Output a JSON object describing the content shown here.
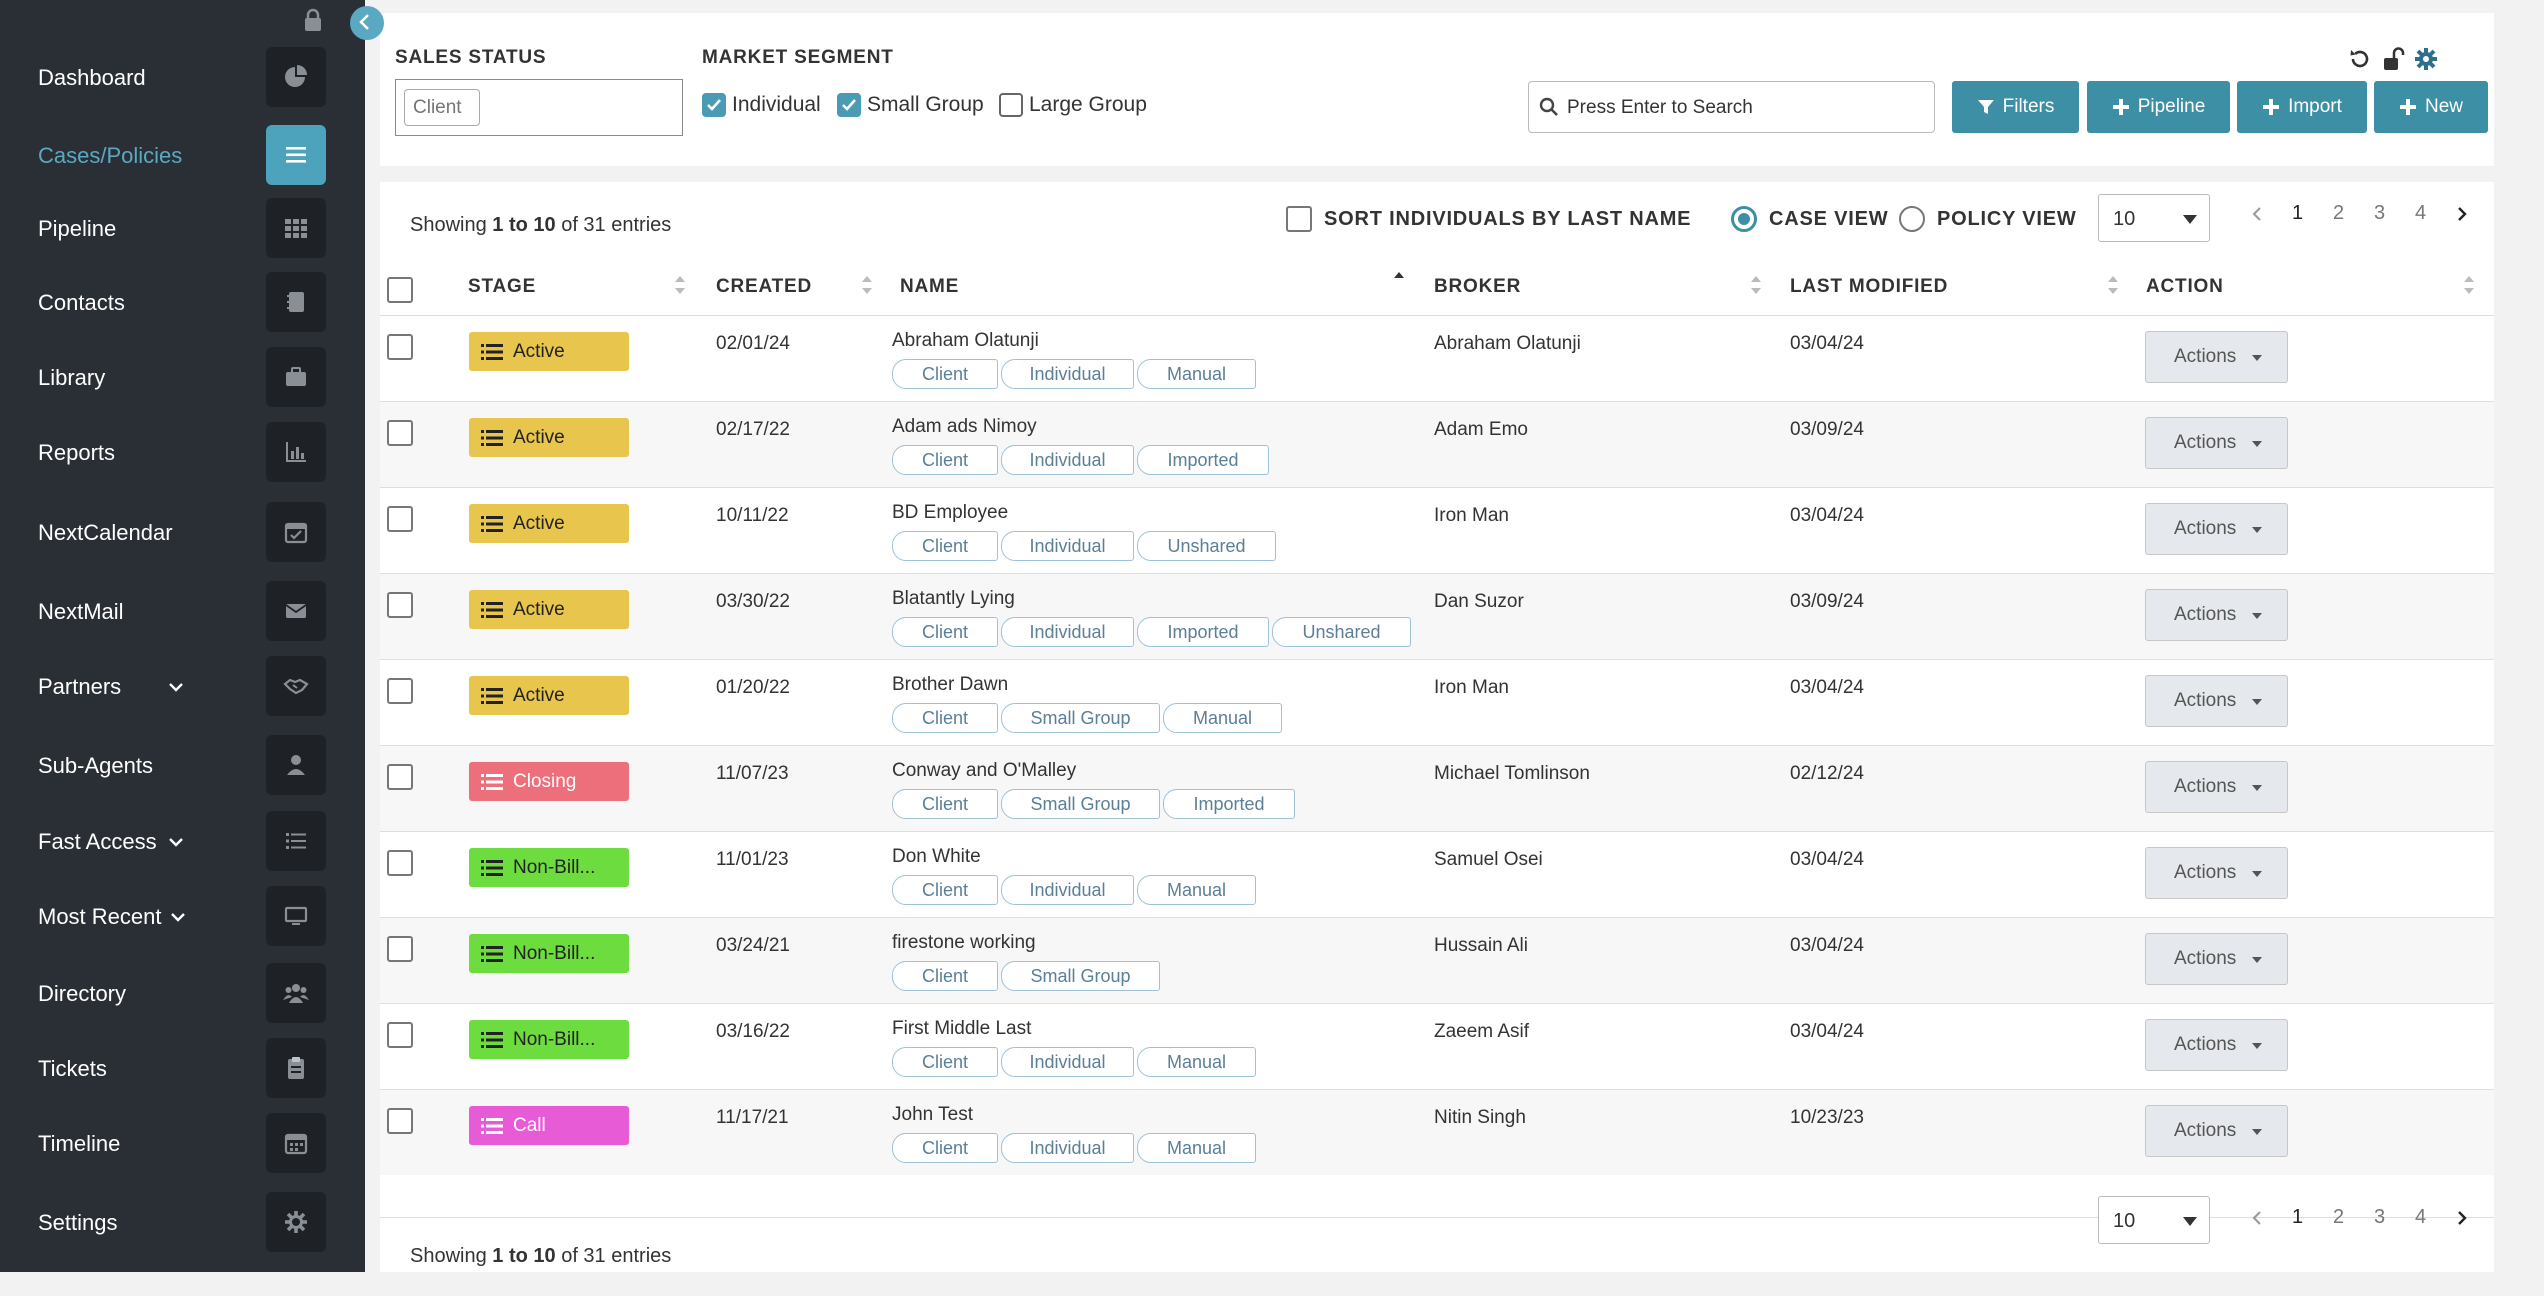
{
  "sidebar": {
    "items": [
      {
        "label": "Dashboard",
        "icon": "pie-chart-icon"
      },
      {
        "label": "Cases/Policies",
        "icon": "list-icon",
        "active": true
      },
      {
        "label": "Pipeline",
        "icon": "grid-icon"
      },
      {
        "label": "Contacts",
        "icon": "address-book-icon"
      },
      {
        "label": "Library",
        "icon": "briefcase-icon"
      },
      {
        "label": "Reports",
        "icon": "bar-chart-icon"
      },
      {
        "label": "NextCalendar",
        "icon": "calendar-check-icon"
      },
      {
        "label": "NextMail",
        "icon": "envelope-icon"
      },
      {
        "label": "Partners",
        "icon": "handshake-icon",
        "expandable": true
      },
      {
        "label": "Sub-Agents",
        "icon": "user-icon"
      },
      {
        "label": "Fast Access",
        "icon": "list-bullets-icon",
        "expandable": true
      },
      {
        "label": "Most Recent",
        "icon": "monitor-icon",
        "expandable": true
      },
      {
        "label": "Directory",
        "icon": "users-icon"
      },
      {
        "label": "Tickets",
        "icon": "clipboard-icon"
      },
      {
        "label": "Timeline",
        "icon": "calendar-icon"
      },
      {
        "label": "Settings",
        "icon": "gear-icon"
      }
    ],
    "accent": "#5aa8c2"
  },
  "filters": {
    "sales_status_title": "SALES STATUS",
    "client_placeholder": "Client",
    "market_segment_title": "MARKET SEGMENT",
    "segments": [
      {
        "label": "Individual",
        "checked": true
      },
      {
        "label": "Small Group",
        "checked": true
      },
      {
        "label": "Large Group",
        "checked": false
      }
    ],
    "search_placeholder": "Press Enter to Search",
    "buttons": {
      "filters": "Filters",
      "pipeline": "Pipeline",
      "import": "Import",
      "new": "New"
    }
  },
  "list": {
    "entries_prefix": "Showing ",
    "entries_range": "1 to 10",
    "entries_suffix": " of 31 entries",
    "sort_individuals_label": "SORT INDIVIDUALS BY LAST NAME",
    "case_view_label": "CASE VIEW",
    "policy_view_label": "POLICY VIEW",
    "page_size": "10",
    "pages": [
      "1",
      "2",
      "3",
      "4"
    ],
    "current_page": "1",
    "columns": {
      "stage": "STAGE",
      "created": "CREATED",
      "name": "NAME",
      "broker": "BROKER",
      "last_modified": "LAST MODIFIED",
      "action": "ACTION"
    },
    "actions_label": "Actions",
    "stage_colors": {
      "Active": "#e8c54d",
      "Closing": "#ec6f7b",
      "Non-Bill...": "#6ddc3f",
      "Call": "#e85bd6"
    },
    "rows": [
      {
        "stage": "Active",
        "created": "02/01/24",
        "name": "Abraham Olatunji",
        "tags": [
          "Client",
          "Individual",
          "Manual"
        ],
        "broker": "Abraham Olatunji",
        "modified": "03/04/24"
      },
      {
        "stage": "Active",
        "created": "02/17/22",
        "name": "Adam ads Nimoy",
        "tags": [
          "Client",
          "Individual",
          "Imported"
        ],
        "broker": "Adam Emo",
        "modified": "03/09/24"
      },
      {
        "stage": "Active",
        "created": "10/11/22",
        "name": "BD Employee",
        "tags": [
          "Client",
          "Individual",
          "Unshared"
        ],
        "broker": "Iron Man",
        "modified": "03/04/24"
      },
      {
        "stage": "Active",
        "created": "03/30/22",
        "name": "Blatantly Lying",
        "tags": [
          "Client",
          "Individual",
          "Imported",
          "Unshared"
        ],
        "broker": "Dan Suzor",
        "modified": "03/09/24"
      },
      {
        "stage": "Active",
        "created": "01/20/22",
        "name": "Brother Dawn",
        "tags": [
          "Client",
          "Small Group",
          "Manual"
        ],
        "broker": "Iron Man",
        "modified": "03/04/24"
      },
      {
        "stage": "Closing",
        "created": "11/07/23",
        "name": "Conway and O'Malley",
        "tags": [
          "Client",
          "Small Group",
          "Imported"
        ],
        "broker": "Michael Tomlinson",
        "modified": "02/12/24"
      },
      {
        "stage": "Non-Bill...",
        "created": "11/01/23",
        "name": "Don White",
        "tags": [
          "Client",
          "Individual",
          "Manual"
        ],
        "broker": "Samuel Osei",
        "modified": "03/04/24"
      },
      {
        "stage": "Non-Bill...",
        "created": "03/24/21",
        "name": "firestone working",
        "tags": [
          "Client",
          "Small Group"
        ],
        "broker": "Hussain Ali",
        "modified": "03/04/24"
      },
      {
        "stage": "Non-Bill...",
        "created": "03/16/22",
        "name": "First Middle Last",
        "tags": [
          "Client",
          "Individual",
          "Manual"
        ],
        "broker": "Zaeem Asif",
        "modified": "03/04/24"
      },
      {
        "stage": "Call",
        "created": "11/17/21",
        "name": "John Test",
        "tags": [
          "Client",
          "Individual",
          "Manual"
        ],
        "broker": "Nitin Singh",
        "modified": "10/23/23"
      }
    ]
  }
}
